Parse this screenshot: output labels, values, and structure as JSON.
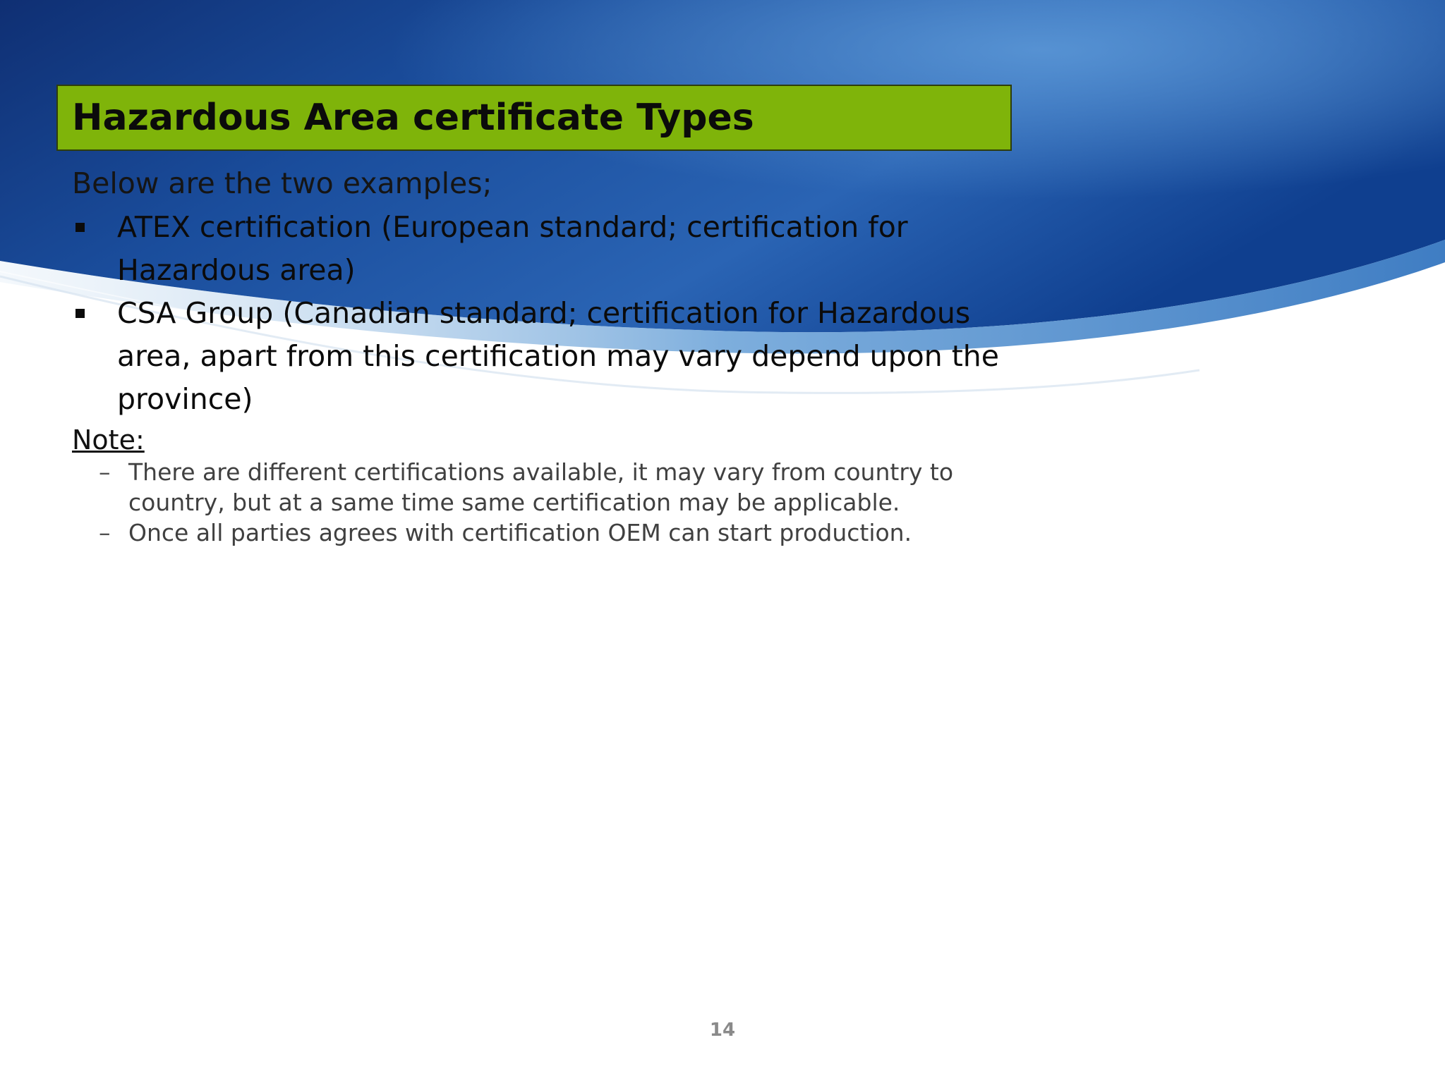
{
  "slide": {
    "title": "Hazardous Area certificate Types",
    "intro": "Below are the two examples;",
    "bullets": [
      {
        "text": "ATEX certification (European standard; certification for Hazardous area)"
      },
      {
        "text": "CSA Group (Canadian standard; certification for Hazardous area, apart from this certification may vary depend upon the province)"
      }
    ],
    "note_label": "Note:",
    "notes": [
      {
        "text": "There are different certifications available, it may vary from country to country, but at a same time same certification may be applicable.",
        "marker": "–"
      },
      {
        "text": "Once all parties agrees with certification OEM can start production.",
        "marker": "–"
      }
    ],
    "page_number": "14"
  },
  "colors": {
    "title_fill": "#7fb40a",
    "title_border": "#2e3d0c",
    "banner_dark": "#0e3c88",
    "banner_light": "#3b7ac3",
    "page_number": "#8a8a8a"
  }
}
